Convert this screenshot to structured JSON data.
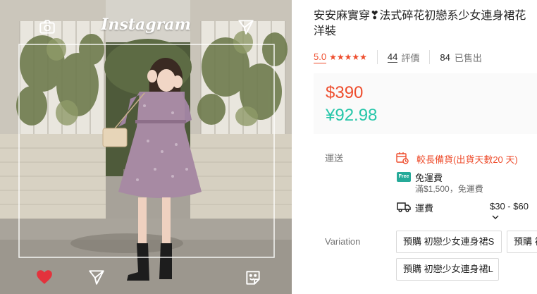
{
  "photo": {
    "watermark": "Instagram",
    "icons": [
      "camera-icon",
      "send-icon",
      "heart-icon",
      "send-icon",
      "sticker-icon"
    ]
  },
  "product": {
    "title": "安安麻實穿❣法式碎花初戀系少女連身裙花洋裝",
    "rating": "5.0",
    "stars": "★★★★★",
    "review_count": "44",
    "review_label": "評價",
    "sold_count": "84",
    "sold_label": "已售出"
  },
  "price": {
    "primary": "$390",
    "secondary": "¥92.98",
    "primary_color": "#ee4d2d",
    "secondary_color": "#26c6a9"
  },
  "shipping": {
    "label": "運送",
    "long_prep": "較長備貨(出貨天數20 天)",
    "free_badge": "Free",
    "free_title": "免運費",
    "free_condition": "滿$1,500，免運費",
    "fee_label": "運費",
    "fee_range": "$30 - $60",
    "fee_chevron": "chevron-down-icon"
  },
  "variation": {
    "label": "Variation",
    "options": [
      "預購 初戀少女連身裙S",
      "預購 初戀少女連身裙M",
      "預購 初戀少女連身裙L"
    ]
  }
}
